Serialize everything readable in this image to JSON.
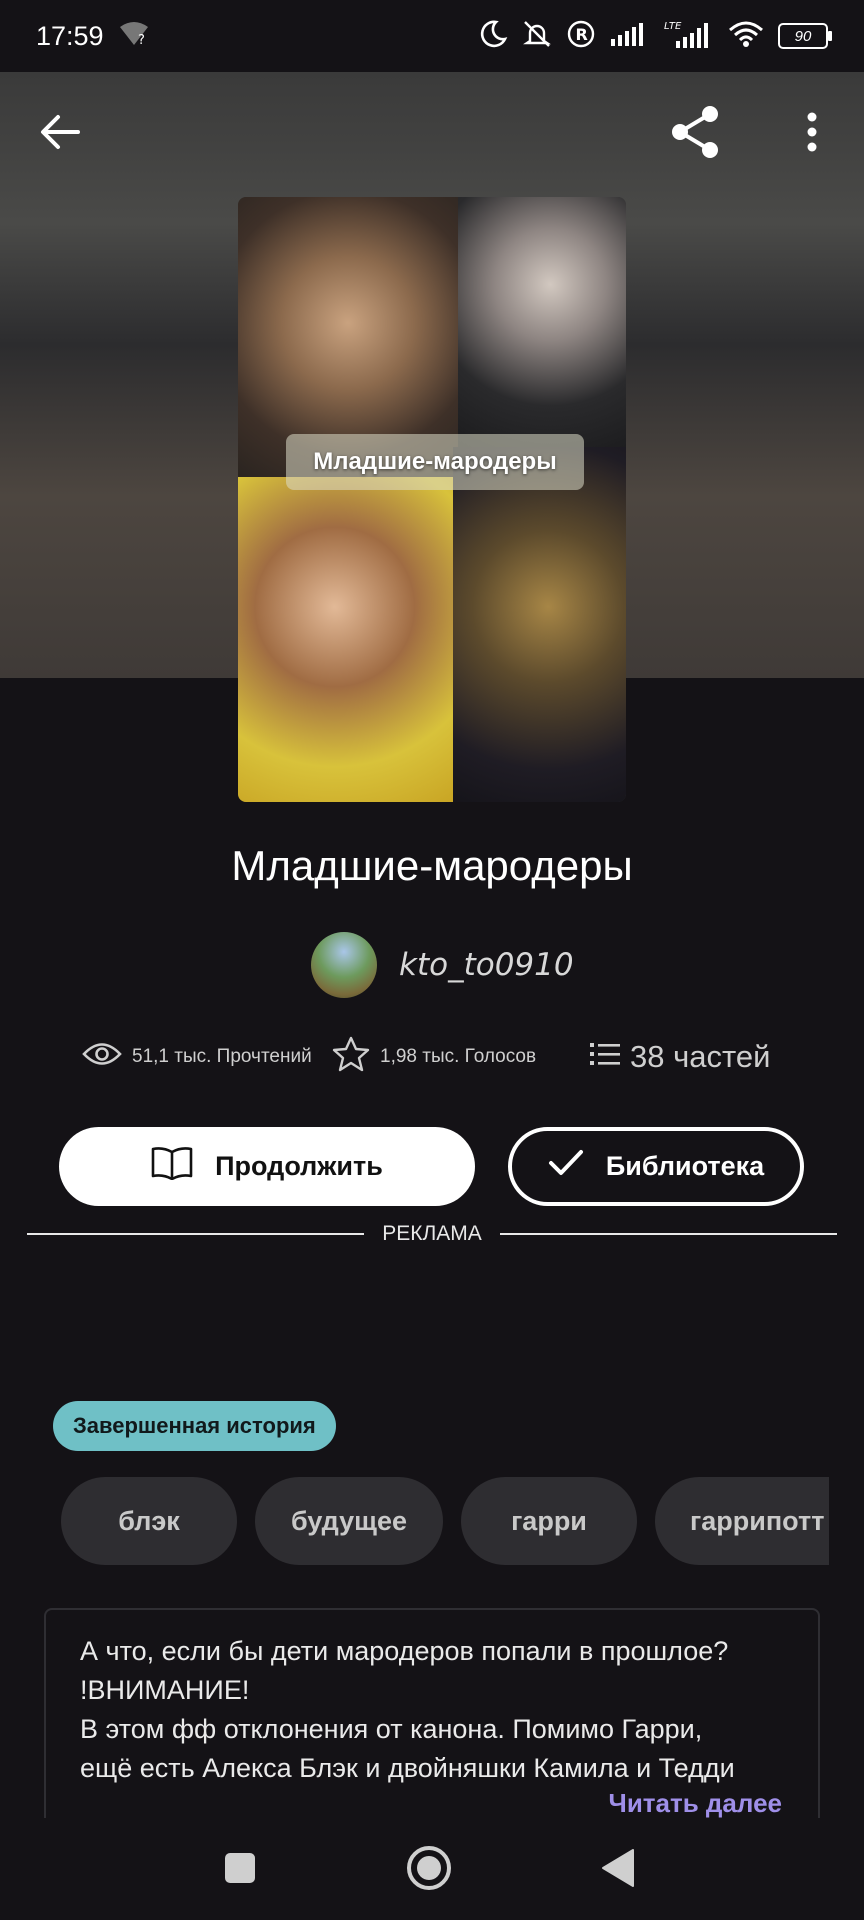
{
  "status_bar": {
    "time": "17:59",
    "battery": "90",
    "icons": [
      "wifi-question-icon",
      "moon-icon",
      "bell-off-icon",
      "registered-icon",
      "signal-icon",
      "lte-signal-icon",
      "wifi-icon",
      "battery-icon"
    ]
  },
  "toolbar": {
    "back_icon": "arrow-left-icon",
    "share_icon": "share-icon",
    "more_icon": "more-vert-icon"
  },
  "cover": {
    "label": "Младшие-мародеры"
  },
  "story": {
    "title": "Младшие-мародеры",
    "author": "kto_to0910",
    "stats": {
      "reads": "51,1 тыс. Прочтений",
      "votes": "1,98 тыс. Голосов",
      "parts": "38 частей"
    }
  },
  "actions": {
    "continue_label": "Продолжить",
    "library_label": "Библиотека"
  },
  "ad": {
    "label": "РЕКЛАМА"
  },
  "status_badge": "Завершенная история",
  "tags": [
    "блэк",
    "будущее",
    "гарри",
    "гаррипотт"
  ],
  "description": {
    "lines": [
      "А что, если бы дети мародеров попали в прошлое?",
      "!ВНИМАНИЕ!",
      "В этом фф отклонения от канона. Помимо Гарри,",
      "ещё есть Алекса Блэк и двойняшки Камила и Тедди"
    ],
    "read_more": "Читать далее"
  },
  "colors": {
    "background": "#141216",
    "badge": "#6fc0c6",
    "tag_bg": "#2e2d31",
    "accent_link": "#9f8fe8"
  }
}
